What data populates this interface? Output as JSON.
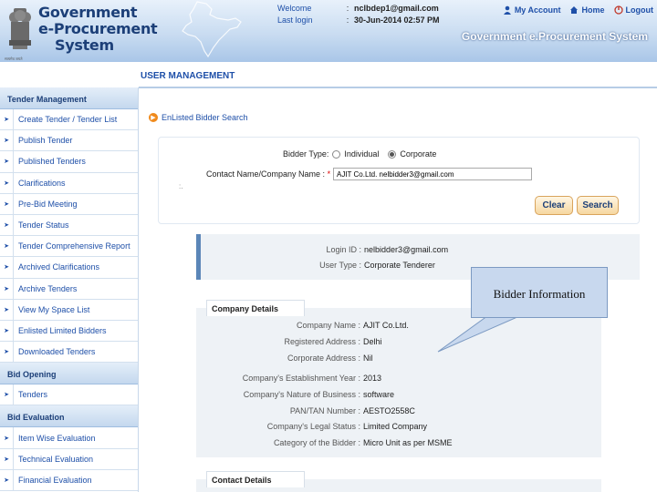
{
  "header": {
    "emblem_caption": "सत्यमेव जयते",
    "brand_lines": [
      "Government",
      "e-Procurement",
      "System"
    ],
    "info": [
      {
        "key": "Welcome",
        "value": "nclbdep1@gmail.com"
      },
      {
        "key": "Last login",
        "value": "30-Jun-2014 02:57 PM"
      }
    ],
    "links": {
      "my_account": "My Account",
      "home": "Home",
      "logout": "Logout"
    },
    "system_title": "Government e.Procurement System"
  },
  "page_title": "USER MANAGEMENT",
  "breadcrumb": "EnListed Bidder Search",
  "sidebar": {
    "sections": [
      {
        "title": "Tender Management",
        "items": [
          "Create Tender / Tender List",
          "Publish Tender",
          "Published Tenders",
          "Clarifications",
          "Pre-Bid Meeting",
          "Tender Status",
          "Tender Comprehensive Report",
          "Archived Clarifications",
          "Archive Tenders",
          "View My Space List",
          "Enlisted Limited Bidders",
          "Downloaded Tenders"
        ]
      },
      {
        "title": "Bid Opening",
        "items": [
          "Tenders"
        ]
      },
      {
        "title": "Bid Evaluation",
        "items": [
          "Item Wise Evaluation",
          "Technical Evaluation",
          "Financial Evaluation"
        ]
      }
    ]
  },
  "search": {
    "bidder_type_label": "Bidder Type:",
    "option_individual": "Individual",
    "option_corporate": "Corporate",
    "contact_label": "Contact Name/Company Name :",
    "required_mark": "*",
    "contact_value": "AJIT Co.Ltd. nelbidder3@gmail.com",
    "dot_mark": ":.",
    "clear_label": "Clear",
    "search_label": "Search"
  },
  "login": {
    "login_id_label": "Login ID :",
    "login_id_value": "nelbidder3@gmail.com",
    "user_type_label": "User Type :",
    "user_type_value": "Corporate Tenderer"
  },
  "company": {
    "tab": "Company Details",
    "rows": [
      {
        "label": "Company Name :",
        "value": "AJIT Co.Ltd."
      },
      {
        "label": "Registered Address :",
        "value": "Delhi"
      },
      {
        "label": "Corporate Address :",
        "value": "Nil"
      },
      {
        "label": "Company's Establishment Year :",
        "value": "2013"
      },
      {
        "label": "Company's Nature of Business :",
        "value": "software"
      },
      {
        "label": "PAN/TAN Number :",
        "value": "AESTO2558C"
      },
      {
        "label": "Company's Legal Status :",
        "value": "Limited Company"
      },
      {
        "label": "Category of the Bidder :",
        "value": "Micro Unit as per MSME"
      }
    ]
  },
  "contact_tab": "Contact Details",
  "callout": "Bidder Information",
  "colors": {
    "accent": "#1e4fa8",
    "orange": "#f08a1c",
    "panel": "#eef2f6"
  }
}
